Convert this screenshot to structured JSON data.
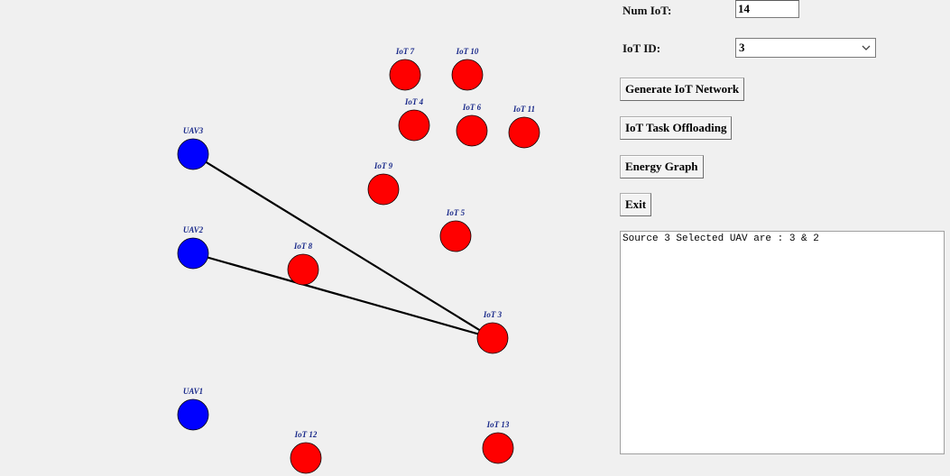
{
  "form": {
    "num_iot_label": "Num IoT:",
    "num_iot_value": "14",
    "iot_id_label": "IoT ID:",
    "iot_id_value": "3"
  },
  "buttons": {
    "generate": "Generate IoT Network",
    "offload": "IoT Task Offloading",
    "energy": "Energy Graph",
    "exit": "Exit"
  },
  "output": {
    "text": "Source 3 Selected UAV are : 3 & 2"
  },
  "colors": {
    "uav": "#0000ff",
    "iot": "#ff0000",
    "label": "#1a2a8a",
    "link": "#000000"
  },
  "network": {
    "uavs": [
      {
        "id": "uav3",
        "label": "UAV3"
      },
      {
        "id": "uav2",
        "label": "UAV2"
      },
      {
        "id": "uav1",
        "label": "UAV1"
      }
    ],
    "iots": [
      {
        "id": "iot7",
        "label": "IoT 7"
      },
      {
        "id": "iot10",
        "label": "IoT 10"
      },
      {
        "id": "iot4",
        "label": "IoT 4"
      },
      {
        "id": "iot6",
        "label": "IoT 6"
      },
      {
        "id": "iot11",
        "label": "IoT 11"
      },
      {
        "id": "iot9",
        "label": "IoT 9"
      },
      {
        "id": "iot5",
        "label": "IoT 5"
      },
      {
        "id": "iot8",
        "label": "IoT 8"
      },
      {
        "id": "iot3",
        "label": "IoT 3"
      },
      {
        "id": "iot12",
        "label": "IoT 12"
      },
      {
        "id": "iot13",
        "label": "IoT 13"
      }
    ],
    "links": [
      {
        "from": "iot3",
        "to": "uav3"
      },
      {
        "from": "iot3",
        "to": "uav2"
      }
    ]
  }
}
